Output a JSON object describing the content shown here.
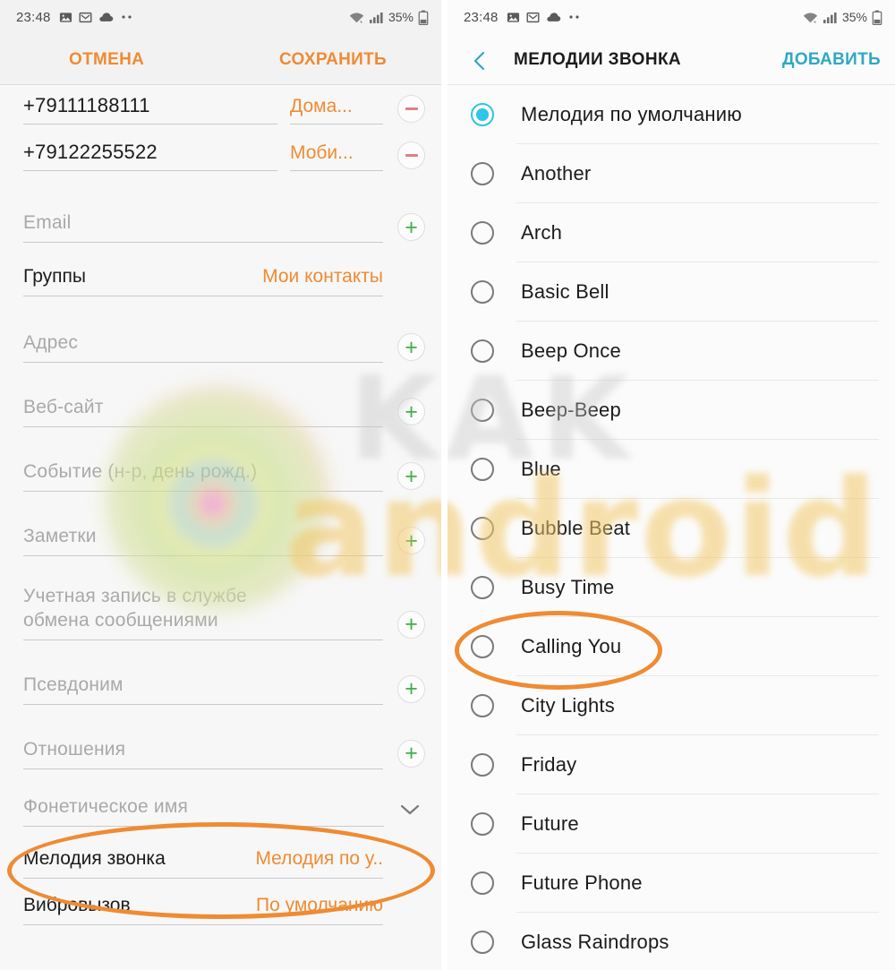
{
  "statusbar": {
    "time": "23:48",
    "icons": [
      "image-icon",
      "gmail-icon",
      "cloud-icon",
      "more-dots-icon"
    ],
    "wifi": "wifi-icon",
    "signal": "signal-bars-icon",
    "battery_text": "35%",
    "battery": "battery-icon"
  },
  "left_panel": {
    "actionbar": {
      "cancel_label": "ОТМЕНА",
      "save_label": "СОХРАНИТЬ"
    },
    "fields": [
      {
        "kind": "phone",
        "value": "+79111188111",
        "type": "Дома...",
        "action": "minus"
      },
      {
        "kind": "phone",
        "value": "+79122255522",
        "type": "Моби...",
        "action": "minus"
      },
      {
        "kind": "placeholder",
        "placeholder": "Email",
        "action": "plus"
      },
      {
        "kind": "labeled",
        "label": "Группы",
        "value": "Мои контакты",
        "action": "none"
      },
      {
        "kind": "placeholder",
        "placeholder": "Адрес",
        "action": "plus"
      },
      {
        "kind": "placeholder",
        "placeholder": "Веб-сайт",
        "action": "plus"
      },
      {
        "kind": "placeholder",
        "placeholder": "Событие (н-р, день рожд.)",
        "action": "plus"
      },
      {
        "kind": "placeholder",
        "placeholder": "Заметки",
        "action": "plus"
      },
      {
        "kind": "placeholder",
        "placeholder": "Учетная запись в службе обмена сообщениями",
        "action": "plus"
      },
      {
        "kind": "placeholder",
        "placeholder": "Псевдоним",
        "action": "plus"
      },
      {
        "kind": "placeholder",
        "placeholder": "Отношения",
        "action": "plus"
      },
      {
        "kind": "placeholder",
        "placeholder": "Фонетическое имя",
        "action": "chevron"
      },
      {
        "kind": "labeled",
        "label": "Мелодия звонка",
        "value": "Мелодия по у..",
        "action": "none"
      },
      {
        "kind": "labeled",
        "label": "Вибровызов",
        "value": "По умолчанию",
        "action": "none"
      }
    ]
  },
  "right_panel": {
    "actionbar": {
      "back_icon": "back-chevron-icon",
      "title": "МЕЛОДИИ ЗВОНКА",
      "add_label": "ДОБАВИТЬ"
    },
    "ringtones": [
      {
        "label": "Мелодия по умолчанию",
        "selected": true
      },
      {
        "label": "Another",
        "selected": false
      },
      {
        "label": "Arch",
        "selected": false
      },
      {
        "label": "Basic Bell",
        "selected": false
      },
      {
        "label": "Beep Once",
        "selected": false
      },
      {
        "label": "Beep-Beep",
        "selected": false
      },
      {
        "label": "Blue",
        "selected": false
      },
      {
        "label": "Bubble Beat",
        "selected": false
      },
      {
        "label": "Busy Time",
        "selected": false
      },
      {
        "label": "Calling You",
        "selected": false,
        "highlighted": true
      },
      {
        "label": "City Lights",
        "selected": false
      },
      {
        "label": "Friday",
        "selected": false
      },
      {
        "label": "Future",
        "selected": false
      },
      {
        "label": "Future Phone",
        "selected": false
      },
      {
        "label": "Glass Raindrops",
        "selected": false
      }
    ]
  },
  "watermark": {
    "text_top": "KAK",
    "text_bottom": "android",
    "blob": "blurred-logo-blob"
  },
  "colors": {
    "accent_orange": "#ef8b33",
    "accent_teal": "#2fa8c4",
    "radio_selected": "#2fc4e8",
    "plus_green": "#3faf46",
    "minus_red": "#e08080"
  }
}
